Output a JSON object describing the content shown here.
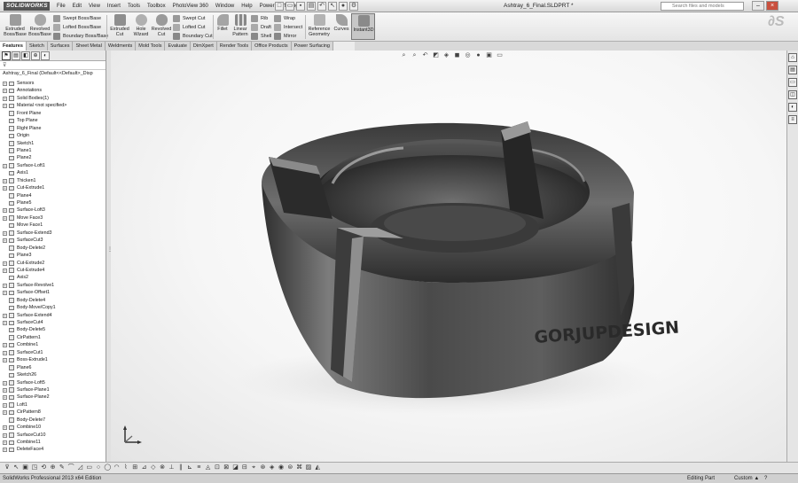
{
  "app": {
    "logo_text": "SOLIDWORKS",
    "doc_title": "Ashtray_6_Final.SLDPRT *",
    "search_placeholder": "Search files and models"
  },
  "menu": [
    "File",
    "Edit",
    "View",
    "Insert",
    "Tools",
    "Toolbox",
    "PhotoView 360",
    "Window",
    "Help",
    "Power Surfacing"
  ],
  "commands": {
    "extruded_boss": "Extruded Boss/Base",
    "revolved_boss": "Revolved Boss/Base",
    "swept_boss": "Swept Boss/Base",
    "lofted_boss": "Lofted Boss/Base",
    "boundary_boss": "Boundary Boss/Base",
    "extruded_cut": "Extruded Cut",
    "hole_wizard": "Hole Wizard",
    "revolved_cut": "Revolved Cut",
    "swept_cut": "Swept Cut",
    "lofted_cut": "Lofted Cut",
    "boundary_cut": "Boundary Cut",
    "fillet": "Fillet",
    "linear_pattern": "Linear Pattern",
    "rib": "Rib",
    "draft": "Draft",
    "shell": "Shell",
    "wrap": "Wrap",
    "intersect": "Intersect",
    "mirror": "Mirror",
    "reference_geometry": "Reference Geometry",
    "curves": "Curves",
    "instant3d": "Instant3D"
  },
  "tabs": [
    "Features",
    "Sketch",
    "Surfaces",
    "Sheet Metal",
    "Weldments",
    "Mold Tools",
    "Evaluate",
    "DimXpert",
    "Render Tools",
    "Office Products",
    "Power Surfacing"
  ],
  "active_tab": "Features",
  "tree": {
    "root": "Ashtray_6_Final  (Default<<Default>_Disp",
    "items": [
      "Sensors",
      "Annotations",
      "Solid Bodies(1)",
      "Material <not specified>",
      "Front Plane",
      "Top Plane",
      "Right Plane",
      "Origin",
      "Sketch1",
      "Plane1",
      "Plane2",
      "Surface-Loft1",
      "Axis1",
      "Thicken1",
      "Cut-Extrude1",
      "Plane4",
      "Plane5",
      "Surface-Loft3",
      "Move Face3",
      "Move Face1",
      "Surface-Extend3",
      "SurfaceCut3",
      "Body-Delete2",
      "Plane3",
      "Cut-Extrude2",
      "Cut-Extrude4",
      "Axis2",
      "Surface-Revolve1",
      "Surface-Offset1",
      "Body-Delete4",
      "Body-Move/Copy1",
      "Surface-Extend4",
      "SurfaceCut4",
      "Body-Delete5",
      "CirPattern1",
      "Combine1",
      "SurfaceCut1",
      "Boss-Extrude1",
      "Plane6",
      "Sketch26",
      "Surface-Loft5",
      "Surface-Plane1",
      "Surface-Plane2",
      "Loft1",
      "CirPattern8",
      "Body-Delete7",
      "Combine10",
      "SurfaceCut10",
      "Combine11",
      "DeleteFace4"
    ]
  },
  "model": {
    "engraving": "GORJUPDESIGN",
    "body_color": "#4a4a4a"
  },
  "status": {
    "edition": "SolidWorks Professional 2013 x64 Edition",
    "mode": "Editing Part",
    "units": "Custom"
  }
}
